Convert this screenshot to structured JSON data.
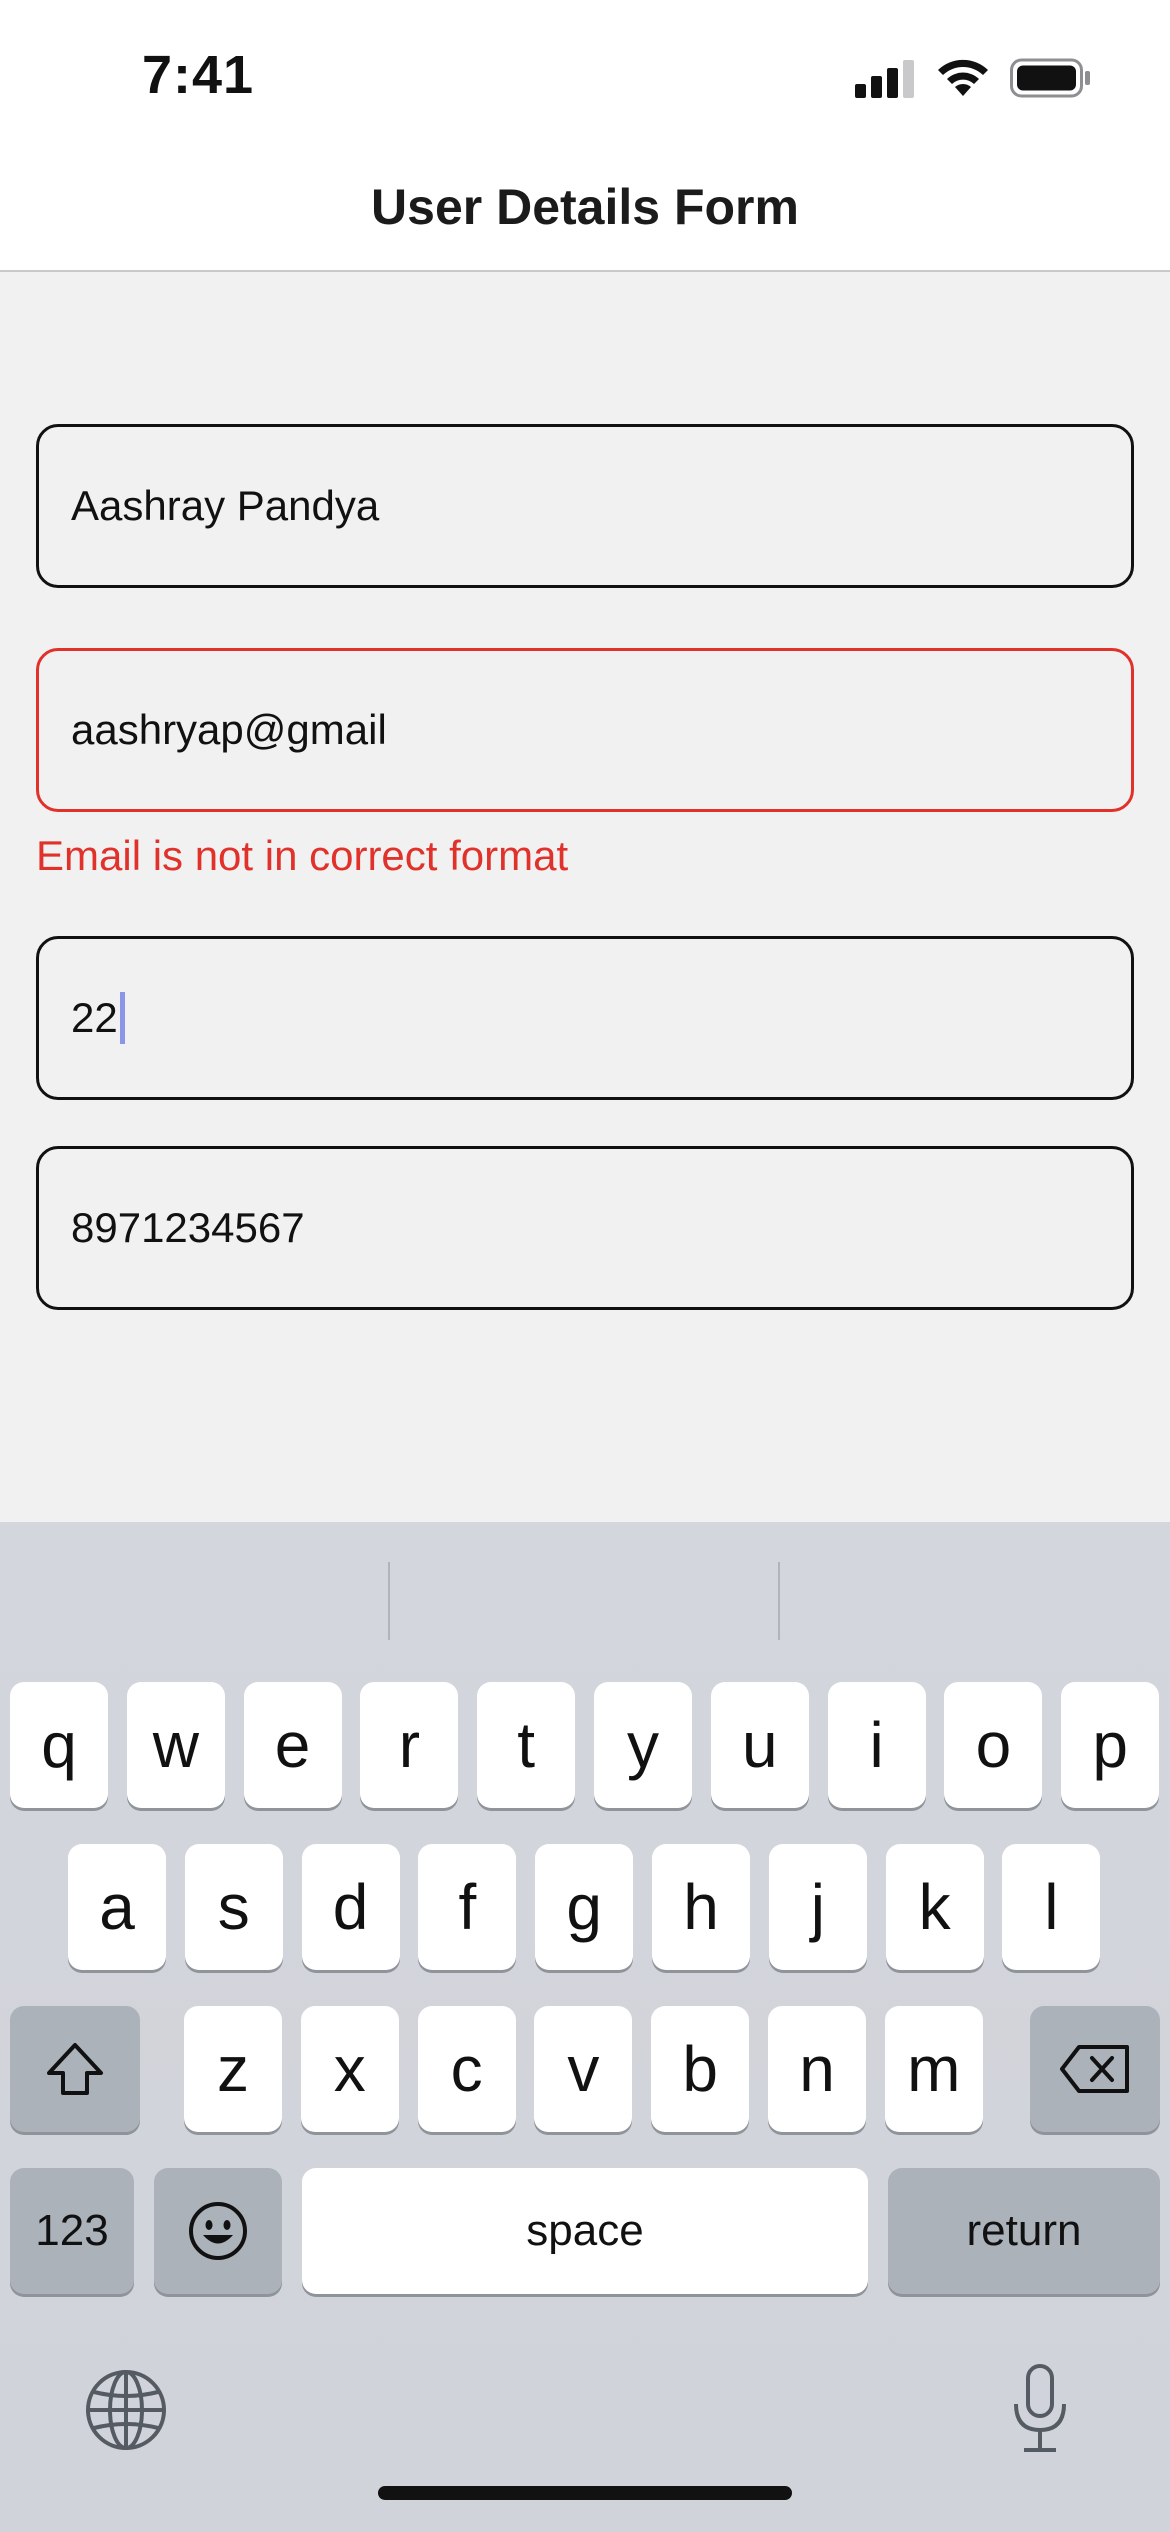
{
  "status_bar": {
    "time": "7:41"
  },
  "nav": {
    "title": "User Details Form"
  },
  "form": {
    "name_value": "Aashray Pandya",
    "email_value": "aashryap@gmail",
    "email_error": "Email is not in correct format",
    "age_value": "22",
    "phone_value": "8971234567"
  },
  "keyboard": {
    "row1": [
      "q",
      "w",
      "e",
      "r",
      "t",
      "y",
      "u",
      "i",
      "o",
      "p"
    ],
    "row2": [
      "a",
      "s",
      "d",
      "f",
      "g",
      "h",
      "j",
      "k",
      "l"
    ],
    "row3": [
      "z",
      "x",
      "c",
      "v",
      "b",
      "n",
      "m"
    ],
    "numbers_label": "123",
    "space_label": "space",
    "return_label": "return"
  },
  "colors": {
    "error": "#e0322b",
    "background": "#f1f1f1"
  },
  "icons": [
    "signal-icon",
    "wifi-icon",
    "battery-icon",
    "shift-icon",
    "delete-icon",
    "emoji-icon",
    "globe-icon",
    "microphone-icon"
  ]
}
